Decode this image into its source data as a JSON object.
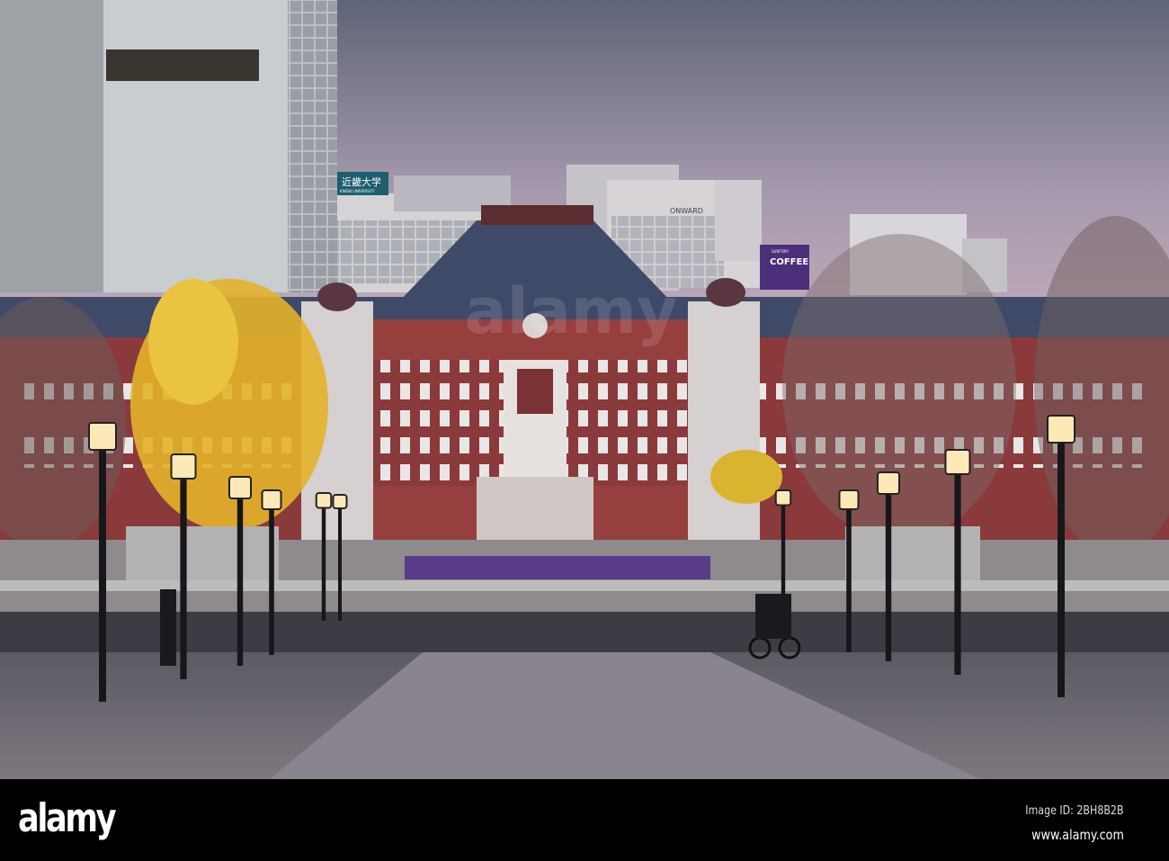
{
  "photo": {
    "subject": "Tokyo Station Marunouchi building at dusk",
    "signs": {
      "university_jp": "近畿大学",
      "university_en": "KINDAI UNIVERSITY",
      "onward": "ONWARD",
      "suntory": "SUNTORY",
      "coffee": "COFFEE"
    },
    "watermark": "alamy"
  },
  "footer": {
    "logo": "alamy",
    "image_id": "Image ID: 2BH8B2B",
    "url": "www.alamy.com"
  },
  "colors": {
    "sky_top": "#5f6478",
    "sky_bottom": "#d9bcc4",
    "brick": "#8a3a3a",
    "roof": "#3e4a68",
    "ginkgo": "#e3b22a",
    "plaza": "#6e6a72"
  }
}
